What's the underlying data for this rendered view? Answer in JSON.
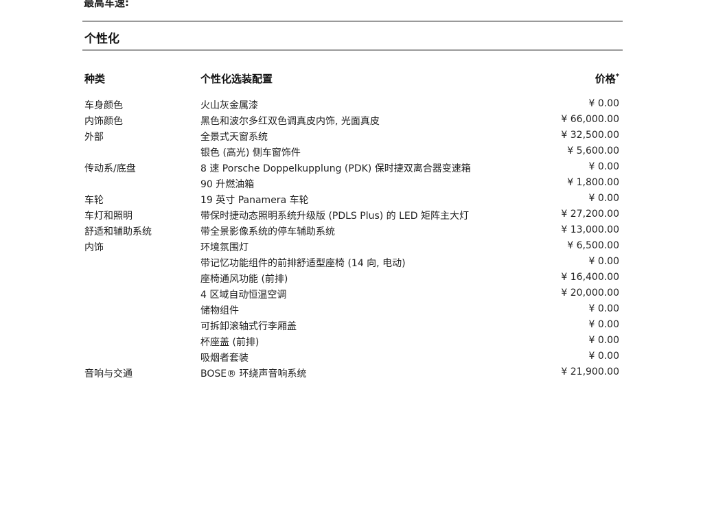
{
  "doc": {
    "top_cut_text": "最高车速:",
    "section_title": "个性化",
    "headers": {
      "category": "种类",
      "option": "个性化选装配置",
      "price": "价格",
      "price_mark": "*"
    },
    "rows": [
      {
        "category": "车身颜色",
        "option": "火山灰金属漆",
        "price": "¥  0.00"
      },
      {
        "category": "内饰颜色",
        "option": "黑色和波尔多红双色调真皮内饰, 光面真皮",
        "price": "¥  66,000.00"
      },
      {
        "category": "外部",
        "option": "全景式天窗系统",
        "price": "¥  32,500.00"
      },
      {
        "category": "",
        "option": "银色 (高光) 侧车窗饰件",
        "price": "¥  5,600.00"
      },
      {
        "category": "传动系/底盘",
        "option": "8 速 Porsche Doppelkupplung (PDK) 保时捷双离合器变速箱",
        "price": "¥  0.00"
      },
      {
        "category": "",
        "option": "90 升燃油箱",
        "price": "¥  1,800.00"
      },
      {
        "category": "车轮",
        "option": "19 英寸 Panamera 车轮",
        "price": "¥  0.00"
      },
      {
        "category": "车灯和照明",
        "option": "带保时捷动态照明系统升级版 (PDLS Plus) 的 LED 矩阵主大灯",
        "price": "¥  27,200.00"
      },
      {
        "category": "舒适和辅助系统",
        "option": "带全景影像系统的停车辅助系统",
        "price": "¥  13,000.00"
      },
      {
        "category": "内饰",
        "option": "环境氛围灯",
        "price": "¥  6,500.00"
      },
      {
        "category": "",
        "option": "带记忆功能组件的前排舒适型座椅 (14 向, 电动)",
        "price": "¥  0.00"
      },
      {
        "category": "",
        "option": "座椅通风功能 (前排)",
        "price": "¥  16,400.00"
      },
      {
        "category": "",
        "option": "4 区域自动恒温空调",
        "price": "¥  20,000.00"
      },
      {
        "category": "",
        "option": "储物组件",
        "price": "¥  0.00"
      },
      {
        "category": "",
        "option": "可拆卸滚轴式行李厢盖",
        "price": "¥  0.00"
      },
      {
        "category": "",
        "option": "杯座盖 (前排)",
        "price": "¥  0.00"
      },
      {
        "category": "",
        "option": "吸烟者套装",
        "price": "¥  0.00"
      },
      {
        "category": "音响与交通",
        "option": "BOSE® 环绕声音响系统",
        "price": "¥  21,900.00"
      }
    ]
  }
}
